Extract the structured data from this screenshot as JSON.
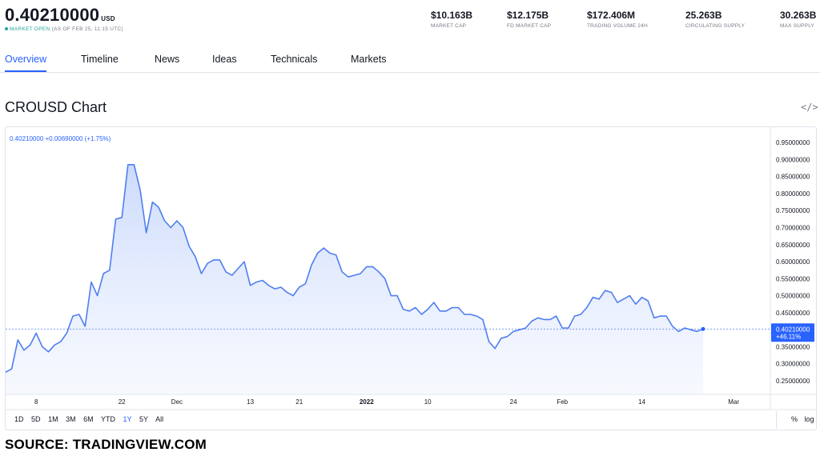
{
  "header": {
    "price": "0.40210000",
    "unit": "USD",
    "status_open": "MARKET OPEN",
    "status_time": "(AS OF FEB 25, 11:15 UTC)",
    "stats": [
      {
        "value": "$10.163B",
        "label": "MARKET CAP"
      },
      {
        "value": "$12.175B",
        "label": "FD MARKET CAP"
      },
      {
        "value": "$172.406M",
        "label": "TRADING VOLUME 24H"
      },
      {
        "value": "25.263B",
        "label": "CIRCULATING SUPPLY"
      },
      {
        "value": "30.263B",
        "label": "MAX SUPPLY"
      }
    ]
  },
  "tabs": [
    "Overview",
    "Timeline",
    "News",
    "Ideas",
    "Technicals",
    "Markets"
  ],
  "active_tab": "Overview",
  "chart_title": "CROUSD Chart",
  "embed_icon": "</>",
  "legend_readout": "0.40210000 +0.00690000 (+1.75%)",
  "range_buttons": [
    "1D",
    "5D",
    "1M",
    "3M",
    "6M",
    "YTD",
    "1Y",
    "5Y",
    "All"
  ],
  "selected_range": "1Y",
  "bottom_controls": [
    "%",
    "log"
  ],
  "source": "SOURCE: TRADINGVIEW.COM",
  "colors": {
    "line": "#4f7ef0",
    "fill_top": "#c9d8fb",
    "price_label_bg": "#2962ff"
  },
  "chart_data": {
    "type": "area",
    "title": "CROUSD Chart",
    "ylim": [
      0.21,
      0.995
    ],
    "y_ticks": [
      "0.95000000",
      "0.90000000",
      "0.85000000",
      "0.80000000",
      "0.75000000",
      "0.70000000",
      "0.65000000",
      "0.60000000",
      "0.55000000",
      "0.50000000",
      "0.45000000",
      "0.40000000",
      "0.35000000",
      "0.30000000",
      "0.25000000"
    ],
    "y_tick_values": [
      0.95,
      0.9,
      0.85,
      0.8,
      0.75,
      0.7,
      0.65,
      0.6,
      0.55,
      0.5,
      0.45,
      0.4,
      0.35,
      0.3,
      0.25
    ],
    "x_ticks": [
      {
        "label": "8",
        "index": 5,
        "bold": false
      },
      {
        "label": "22",
        "index": 19,
        "bold": false
      },
      {
        "label": "Dec",
        "index": 28,
        "bold": false
      },
      {
        "label": "13",
        "index": 40,
        "bold": false
      },
      {
        "label": "21",
        "index": 48,
        "bold": false
      },
      {
        "label": "2022",
        "index": 59,
        "bold": true
      },
      {
        "label": "10",
        "index": 69,
        "bold": false
      },
      {
        "label": "24",
        "index": 83,
        "bold": false
      },
      {
        "label": "Feb",
        "index": 91,
        "bold": false
      },
      {
        "label": "14",
        "index": 104,
        "bold": false
      },
      {
        "label": "Mar",
        "index": 119,
        "bold": false
      }
    ],
    "x_index_range": [
      0,
      125
    ],
    "last_price_label": "0.40210000",
    "last_change_label": "+46.11%",
    "last_value": 0.4021,
    "values": [
      0.275,
      0.285,
      0.37,
      0.34,
      0.355,
      0.39,
      0.35,
      0.335,
      0.355,
      0.365,
      0.39,
      0.44,
      0.445,
      0.41,
      0.54,
      0.5,
      0.565,
      0.575,
      0.725,
      0.73,
      0.885,
      0.885,
      0.81,
      0.685,
      0.775,
      0.76,
      0.72,
      0.7,
      0.72,
      0.7,
      0.645,
      0.615,
      0.565,
      0.595,
      0.605,
      0.605,
      0.57,
      0.56,
      0.58,
      0.6,
      0.53,
      0.54,
      0.545,
      0.53,
      0.52,
      0.525,
      0.51,
      0.5,
      0.525,
      0.535,
      0.59,
      0.625,
      0.64,
      0.625,
      0.62,
      0.57,
      0.555,
      0.56,
      0.565,
      0.585,
      0.585,
      0.57,
      0.55,
      0.5,
      0.5,
      0.46,
      0.455,
      0.465,
      0.445,
      0.46,
      0.48,
      0.455,
      0.455,
      0.465,
      0.465,
      0.445,
      0.445,
      0.44,
      0.43,
      0.365,
      0.345,
      0.375,
      0.38,
      0.395,
      0.4,
      0.405,
      0.425,
      0.435,
      0.43,
      0.43,
      0.44,
      0.405,
      0.405,
      0.44,
      0.445,
      0.465,
      0.495,
      0.49,
      0.515,
      0.51,
      0.48,
      0.49,
      0.5,
      0.475,
      0.495,
      0.485,
      0.435,
      0.44,
      0.44,
      0.41,
      0.395,
      0.405,
      0.4,
      0.395,
      0.4021
    ]
  }
}
